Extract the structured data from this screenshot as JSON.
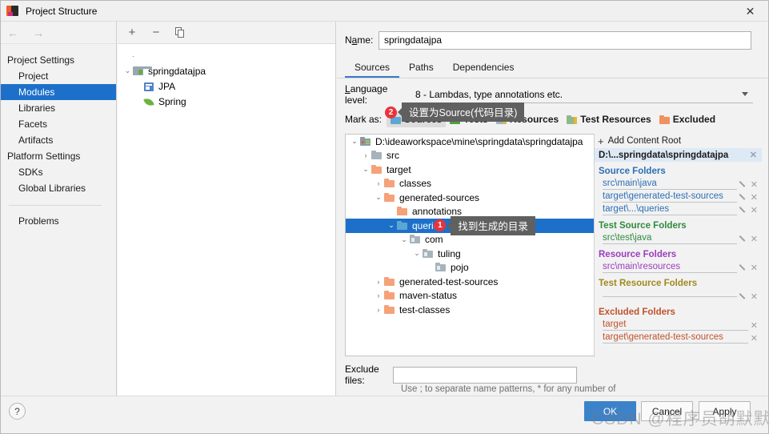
{
  "window": {
    "title": "Project Structure",
    "close_label": "✕",
    "app_icon": "intellij-idea-icon"
  },
  "nav": {
    "back": "←",
    "forward": "→"
  },
  "sidebar": {
    "groups": [
      {
        "label": "Project Settings",
        "items": [
          {
            "label": "Project",
            "selected": false
          },
          {
            "label": "Modules",
            "selected": true
          },
          {
            "label": "Libraries",
            "selected": false
          },
          {
            "label": "Facets",
            "selected": false
          },
          {
            "label": "Artifacts",
            "selected": false
          }
        ]
      },
      {
        "label": "Platform Settings",
        "items": [
          {
            "label": "SDKs",
            "selected": false
          },
          {
            "label": "Global Libraries",
            "selected": false
          }
        ]
      }
    ],
    "problems": "Problems"
  },
  "modules_panel": {
    "toolbar": {
      "add": "+",
      "remove": "−",
      "copy": "copy-icon"
    },
    "tree": [
      {
        "label": "springdatajpa",
        "level": 0,
        "twisty": "⌄",
        "icon": "module-folder-icon"
      },
      {
        "label": "JPA",
        "level": 1,
        "twisty": "",
        "icon": "jpa-facet-icon"
      },
      {
        "label": "Spring",
        "level": 1,
        "twisty": "",
        "icon": "spring-facet-icon"
      }
    ]
  },
  "detail": {
    "name_label": "Name:",
    "name_value": "springdatajpa",
    "tabs": [
      {
        "label": "Sources",
        "active": true
      },
      {
        "label": "Paths",
        "active": false
      },
      {
        "label": "Dependencies",
        "active": false
      }
    ],
    "language_level_label": "Language level:",
    "language_level_value": "8 - Lambdas, type annotations etc.",
    "mark_as_label": "Mark as:",
    "mark_as_buttons": [
      {
        "label": "Sources",
        "color": "blue",
        "pressed": true
      },
      {
        "label": "Tests",
        "color": "green",
        "pressed": false
      },
      {
        "label": "Resources",
        "color": "res",
        "pressed": false
      },
      {
        "label": "Test Resources",
        "color": "tres",
        "pressed": false
      },
      {
        "label": "Excluded",
        "color": "orange",
        "pressed": false
      }
    ],
    "exclude_files_label": "Exclude files:",
    "exclude_files_value": "",
    "exclude_hint": "Use ; to separate name patterns, * for any number of symbols, ? for one."
  },
  "annotations": [
    {
      "badge": "1",
      "text": "找到生成的目录"
    },
    {
      "badge": "2",
      "text": "设置为Source(代码目录)"
    }
  ],
  "file_tree": [
    {
      "label": "D:\\ideaworkspace\\mine\\springdata\\springdatajpa",
      "indent": 0,
      "twisty": "⌄",
      "icon": "content-root-icon",
      "icon_class": "root",
      "selected": false
    },
    {
      "label": "src",
      "indent": 1,
      "twisty": "›",
      "icon": "folder-icon",
      "icon_class": "gray",
      "selected": false
    },
    {
      "label": "target",
      "indent": 1,
      "twisty": "⌄",
      "icon": "folder-icon",
      "icon_class": "orange",
      "selected": false
    },
    {
      "label": "classes",
      "indent": 2,
      "twisty": "›",
      "icon": "folder-icon",
      "icon_class": "orange",
      "selected": false
    },
    {
      "label": "generated-sources",
      "indent": 2,
      "twisty": "⌄",
      "icon": "folder-icon",
      "icon_class": "orange",
      "selected": false
    },
    {
      "label": "annotations",
      "indent": 3,
      "twisty": "",
      "icon": "folder-icon",
      "icon_class": "orange",
      "selected": false
    },
    {
      "label": "queries",
      "indent": 3,
      "twisty": "⌄",
      "icon": "source-folder-icon",
      "icon_class": "blue",
      "selected": true,
      "badge": "1",
      "tooltip": "找到生成的目录"
    },
    {
      "label": "com",
      "indent": 4,
      "twisty": "⌄",
      "icon": "package-icon",
      "icon_class": "pkg",
      "selected": false
    },
    {
      "label": "tuling",
      "indent": 5,
      "twisty": "⌄",
      "icon": "package-icon",
      "icon_class": "pkg",
      "selected": false
    },
    {
      "label": "pojo",
      "indent": 6,
      "twisty": "",
      "icon": "package-icon",
      "icon_class": "pkg",
      "selected": false
    },
    {
      "label": "generated-test-sources",
      "indent": 2,
      "twisty": "›",
      "icon": "folder-icon",
      "icon_class": "orange",
      "selected": false
    },
    {
      "label": "maven-status",
      "indent": 2,
      "twisty": "›",
      "icon": "folder-icon",
      "icon_class": "orange",
      "selected": false
    },
    {
      "label": "test-classes",
      "indent": 2,
      "twisty": "›",
      "icon": "folder-icon",
      "icon_class": "orange",
      "selected": false
    }
  ],
  "folders_panel": {
    "add_content_root": "Add Content Root",
    "content_root": "D:\\...springdata\\springdatajpa",
    "groups": [
      {
        "title": "Source Folders",
        "cls": "src",
        "items": [
          {
            "path": "src\\main\\java",
            "editable": true
          },
          {
            "path": "target\\generated-test-sources",
            "editable": true
          },
          {
            "path": "target\\...\\queries",
            "editable": true
          }
        ]
      },
      {
        "title": "Test Source Folders",
        "cls": "tsrc",
        "items": [
          {
            "path": "src\\test\\java",
            "editable": true
          }
        ]
      },
      {
        "title": "Resource Folders",
        "cls": "res",
        "items": [
          {
            "path": "src\\main\\resources",
            "editable": true
          }
        ]
      },
      {
        "title": "Test Resource Folders",
        "cls": "tres",
        "items": [
          {
            "path": "",
            "editable": true
          }
        ]
      },
      {
        "title": "Excluded Folders",
        "cls": "exc",
        "items": [
          {
            "path": "target",
            "editable": false
          },
          {
            "path": "target\\generated-test-sources",
            "editable": false
          }
        ]
      }
    ]
  },
  "footer": {
    "help": "?",
    "ok": "OK",
    "cancel": "Cancel",
    "apply": "Apply"
  },
  "watermark": "CSDN @程序员胡默默",
  "colors": {
    "accent": "#3c82c9",
    "selection": "#1d70c9",
    "badge": "#e8333a",
    "source": "#2d6fb5",
    "test_source": "#2e8b3d",
    "resource": "#9c3dbd",
    "test_resource": "#a08a1e",
    "excluded": "#c0522d"
  }
}
